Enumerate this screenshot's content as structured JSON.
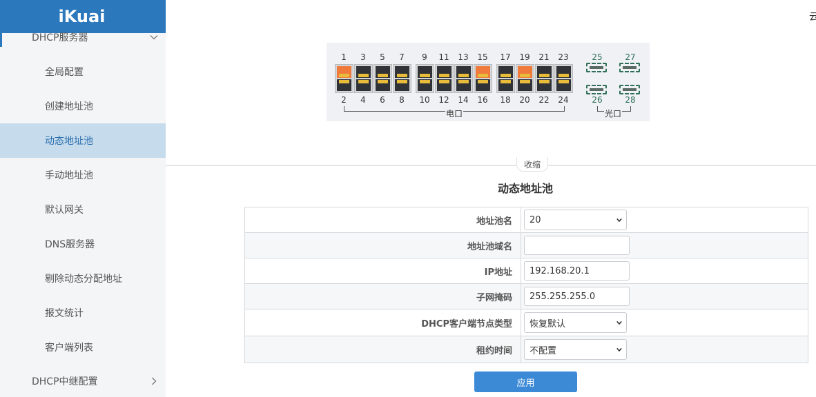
{
  "app": {
    "logo": "iKuai"
  },
  "corner_text": "云",
  "sidebar": {
    "group_top": "DHCP服务器",
    "items": [
      {
        "label": "全局配置"
      },
      {
        "label": "创建地址池"
      },
      {
        "label": "动态地址池",
        "active": true
      },
      {
        "label": "手动地址池"
      },
      {
        "label": "默认网关"
      },
      {
        "label": "DNS服务器"
      },
      {
        "label": "剔除动态分配地址"
      },
      {
        "label": "报文统计"
      },
      {
        "label": "客户端列表"
      }
    ],
    "group_bottom": "DHCP中继配置"
  },
  "ports": {
    "electric_label": "电口",
    "optical_label": "光口",
    "rj45": [
      {
        "top": "1",
        "bottom": "2",
        "active_top": true,
        "active_bottom": false
      },
      {
        "top": "3",
        "bottom": "4",
        "active_top": false,
        "active_bottom": false
      },
      {
        "top": "5",
        "bottom": "6",
        "active_top": false,
        "active_bottom": false
      },
      {
        "top": "7",
        "bottom": "8",
        "active_top": false,
        "active_bottom": false
      },
      {
        "top": "9",
        "bottom": "10",
        "active_top": false,
        "active_bottom": false
      },
      {
        "top": "11",
        "bottom": "12",
        "active_top": false,
        "active_bottom": false
      },
      {
        "top": "13",
        "bottom": "14",
        "active_top": false,
        "active_bottom": false
      },
      {
        "top": "15",
        "bottom": "16",
        "active_top": true,
        "active_bottom": false
      },
      {
        "top": "17",
        "bottom": "18",
        "active_top": false,
        "active_bottom": false
      },
      {
        "top": "19",
        "bottom": "20",
        "active_top": true,
        "active_bottom": false
      },
      {
        "top": "21",
        "bottom": "22",
        "active_top": false,
        "active_bottom": false
      },
      {
        "top": "23",
        "bottom": "24",
        "active_top": false,
        "active_bottom": false
      }
    ],
    "sfp": [
      {
        "top": "25",
        "bottom": "26"
      },
      {
        "top": "27",
        "bottom": "28"
      }
    ]
  },
  "collapse_label": "收缩",
  "section_title": "动态地址池",
  "form": {
    "pool_name": {
      "label": "地址池名",
      "value": "20"
    },
    "pool_domain": {
      "label": "地址池域名",
      "value": ""
    },
    "ip": {
      "label": "IP地址",
      "value": "192.168.20.1"
    },
    "mask": {
      "label": "子网掩码",
      "value": "255.255.255.0"
    },
    "node_type": {
      "label": "DHCP客户端节点类型",
      "value": "恢复默认"
    },
    "lease": {
      "label": "租约时间",
      "value": "不配置"
    }
  },
  "apply_label": "应用",
  "colors": {
    "brand": "#2b78bd",
    "active_port": "#f07a3c",
    "button": "#3c8ad6"
  }
}
